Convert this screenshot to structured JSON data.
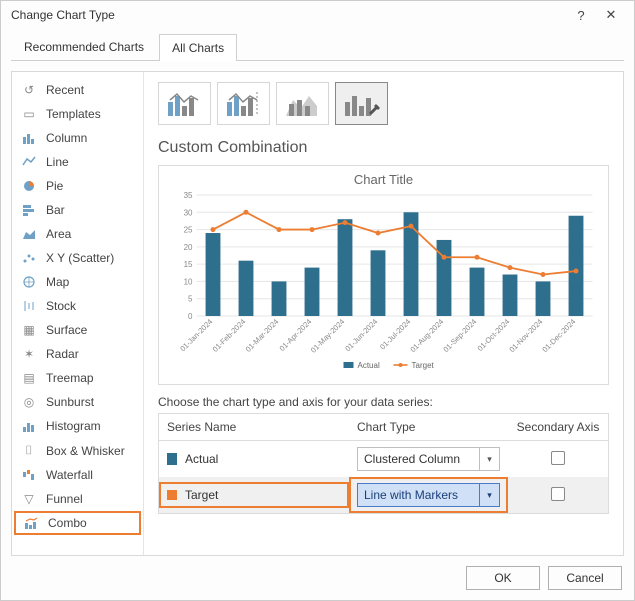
{
  "window": {
    "title": "Change Chart Type"
  },
  "tabs": {
    "recommended": "Recommended Charts",
    "all": "All Charts"
  },
  "sidebar": {
    "items": [
      {
        "label": "Recent"
      },
      {
        "label": "Templates"
      },
      {
        "label": "Column"
      },
      {
        "label": "Line"
      },
      {
        "label": "Pie"
      },
      {
        "label": "Bar"
      },
      {
        "label": "Area"
      },
      {
        "label": "X Y (Scatter)"
      },
      {
        "label": "Map"
      },
      {
        "label": "Stock"
      },
      {
        "label": "Surface"
      },
      {
        "label": "Radar"
      },
      {
        "label": "Treemap"
      },
      {
        "label": "Sunburst"
      },
      {
        "label": "Histogram"
      },
      {
        "label": "Box & Whisker"
      },
      {
        "label": "Waterfall"
      },
      {
        "label": "Funnel"
      },
      {
        "label": "Combo"
      }
    ]
  },
  "main": {
    "section_title": "Custom Combination",
    "instruction": "Choose the chart type and axis for your data series:",
    "headers": {
      "name": "Series Name",
      "type": "Chart Type",
      "axis": "Secondary Axis"
    },
    "series": [
      {
        "name": "Actual",
        "type_label": "Clustered Column"
      },
      {
        "name": "Target",
        "type_label": "Line with Markers"
      }
    ]
  },
  "buttons": {
    "ok": "OK",
    "cancel": "Cancel"
  },
  "chart_data": {
    "type": "combo",
    "title": "Chart Title",
    "categories": [
      "01-Jan-2024",
      "01-Feb-2024",
      "01-Mar-2024",
      "01-Apr-2024",
      "01-May-2024",
      "01-Jun-2024",
      "01-Jul-2024",
      "01-Aug-2024",
      "01-Sep-2024",
      "01-Oct-2024",
      "01-Nov-2024",
      "01-Dec-2024"
    ],
    "series": [
      {
        "name": "Actual",
        "kind": "bar",
        "color": "#2e6f8e",
        "values": [
          24,
          16,
          10,
          14,
          28,
          19,
          30,
          22,
          14,
          12,
          10,
          29
        ]
      },
      {
        "name": "Target",
        "kind": "line",
        "color": "#ec7d31",
        "values": [
          25,
          30,
          25,
          25,
          27,
          24,
          26,
          17,
          17,
          14,
          12,
          13
        ]
      }
    ],
    "ylim": [
      0,
      35
    ],
    "yticks": [
      0,
      5,
      10,
      15,
      20,
      25,
      30,
      35
    ],
    "legend": {
      "actual": "Actual",
      "target": "Target"
    }
  }
}
